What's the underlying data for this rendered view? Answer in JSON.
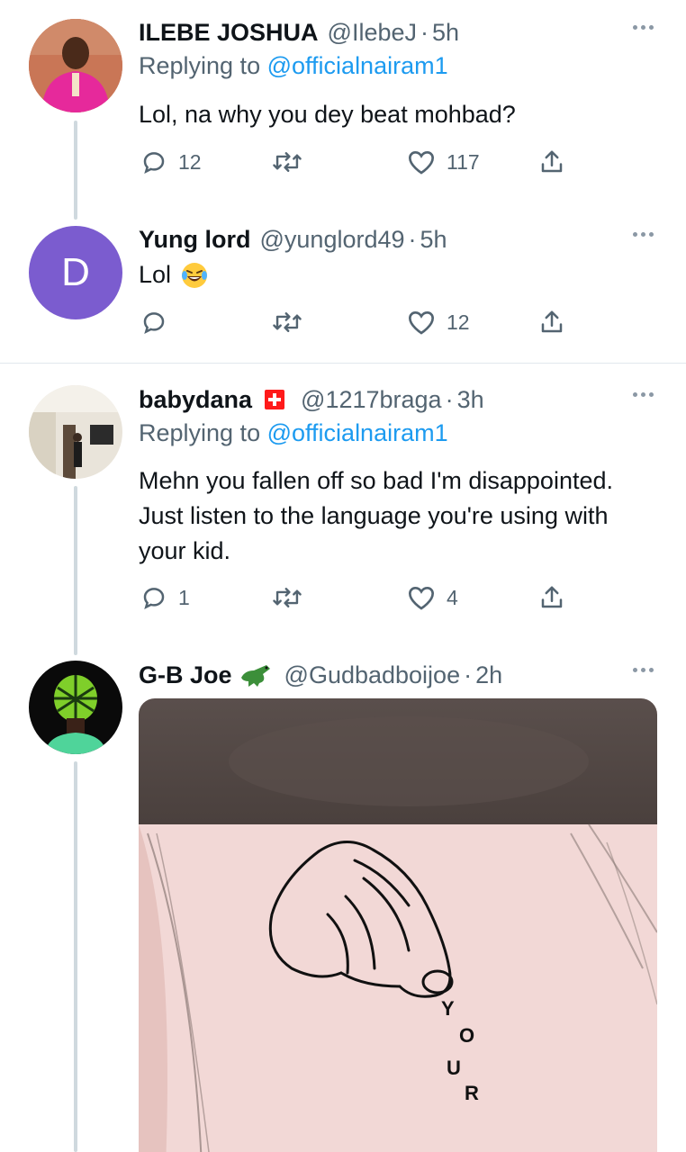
{
  "tweets": [
    {
      "name": "ILEBE JOSHUA",
      "handle": "@IlebeJ",
      "dot": "·",
      "time": "5h",
      "replying_prefix": "Replying to",
      "replying_to": "@officialnairam1",
      "text": "Lol, na why you dey beat  mohbad?",
      "replies": "12",
      "retweets": "",
      "likes": "117"
    },
    {
      "name": "Yung lord",
      "handle": "@yunglord49",
      "dot": "·",
      "time": "5h",
      "avatar_letter": "D",
      "text": "Lol",
      "emoji": "😂",
      "replies": "",
      "retweets": "",
      "likes": "12"
    },
    {
      "name": "babydana",
      "handle": "@1217braga",
      "dot": "·",
      "time": "3h",
      "replying_prefix": "Replying to",
      "replying_to": "@officialnairam1",
      "text": "Mehn you fallen off so bad I'm disappointed. Just listen to the language you're using with your kid.",
      "replies": "1",
      "retweets": "",
      "likes": "4"
    },
    {
      "name": "G-B Joe",
      "handle": "@Gudbadboijoe",
      "dot": "·",
      "time": "2h",
      "media_letters": [
        "Y",
        "O",
        "U",
        "R"
      ]
    }
  ],
  "colors": {
    "accent": "#1d9bf0",
    "secondary_text": "#536471",
    "avatar_purple": "#7b5ccf"
  }
}
